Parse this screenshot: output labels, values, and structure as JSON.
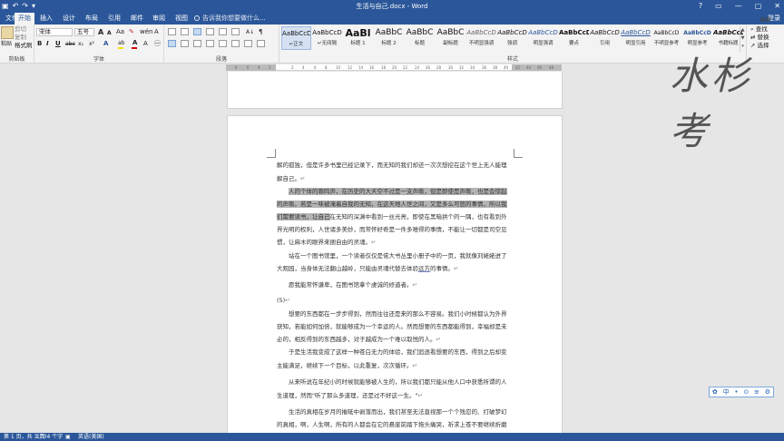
{
  "window": {
    "title": "生活与自己.docx - Word",
    "controls": [
      "?",
      "▭",
      "—",
      "▢",
      "✕"
    ]
  },
  "quick_access": [
    "save-icon",
    "undo-icon",
    "redo-icon",
    "customize-icon"
  ],
  "tabs": {
    "file": "文件",
    "home": "开始",
    "insert": "插入",
    "design": "设计",
    "layout": "布局",
    "references": "引用",
    "mailings": "邮件",
    "review": "审阅",
    "view": "视图",
    "tell_me": "告诉我你想要做什么...",
    "sign_in": "登录"
  },
  "clipboard": {
    "paste": "粘贴",
    "cut": "剪切",
    "copy": "复制",
    "format_painter": "格式刷",
    "label": "剪贴板"
  },
  "font": {
    "name": "宋体",
    "size": "五号",
    "grow": "A",
    "shrink": "A",
    "case": "Aa",
    "bold": "B",
    "italic": "I",
    "underline": "U",
    "strike": "abc",
    "sub": "x₂",
    "sup": "x²",
    "effects": "A",
    "highlight": "ab",
    "color": "A",
    "label": "字体",
    "highlight_color": "#f2e000",
    "font_color": "#d40000"
  },
  "paragraph": {
    "label": "段落",
    "sort": "A↓",
    "marks": "¶"
  },
  "styles": {
    "label": "样式",
    "items": [
      {
        "preview": "AaBbCcD",
        "name": "↵正文"
      },
      {
        "preview": "AaBbCcD",
        "name": "↵无间隔"
      },
      {
        "preview": "AaBl",
        "name": "标题 1"
      },
      {
        "preview": "AaBbC",
        "name": "标题 2"
      },
      {
        "preview": "AaBbC",
        "name": "标题"
      },
      {
        "preview": "AaBbC",
        "name": "副标题"
      },
      {
        "preview": "AaBbCcD",
        "name": "不明显强调"
      },
      {
        "preview": "AaBbCcD",
        "name": "强调"
      },
      {
        "preview": "AaBbCcD",
        "name": "明显强调"
      },
      {
        "preview": "AaBbCcD",
        "name": "要点"
      },
      {
        "preview": "AaBbCcD",
        "name": "引用"
      },
      {
        "preview": "AaBbCcD",
        "name": "明显引用"
      },
      {
        "preview": "AaBbCcD",
        "name": "不明显参考"
      },
      {
        "preview": "AaBbCcD",
        "name": "明显参考"
      },
      {
        "preview": "AaBbCcD",
        "name": "书籍标题"
      }
    ]
  },
  "editing": {
    "find": "查找",
    "replace": "替换",
    "select": "选择",
    "label": "编辑"
  },
  "ruler_ticks": [
    "8",
    "6",
    "4",
    "2",
    "",
    "2",
    "4",
    "6",
    "8",
    "10",
    "12",
    "14",
    "16",
    "18",
    "20",
    "22",
    "24",
    "26",
    "28",
    "30",
    "32",
    "34",
    "36",
    "38",
    "40",
    "42",
    "44",
    "46",
    "48"
  ],
  "document": {
    "lines": [
      {
        "pre": "解的孤独，但是许多书里已经记录下，而无知的我们却还一次次想挖在这个世上无人能理",
        "hl": "",
        "post": "",
        "ul": ""
      },
      {
        "pre": "解自己。",
        "hl": "",
        "post": "",
        "ul": "",
        "mark": "↵"
      },
      {
        "pre": "",
        "hl": "人的个体的嘶鸣声，在历史的大天空不过是一支声嘶，但是即使是声嘶，也是会惊起",
        "post": "",
        "ul": ""
      },
      {
        "pre": "",
        "hl": "的声嘶。若是一味被淹着自我的无知，在这天地人世之间，又是多么可怒的事情，所以我",
        "post": "",
        "ul": ""
      },
      {
        "pre": "",
        "hl": "们需要读书，让自己",
        "post": "在无知的深渊中看到一丝光亮，即使在黑暗拱个的一隅，也有看到外",
        "ul": ""
      },
      {
        "pre": "界光明的权利，人世诸多美妙，而常怀好奇是一件多难得的事情，不能让一切都是司空见",
        "hl": "",
        "post": "",
        "ul": ""
      },
      {
        "pre": "惯，让麻木的眼界来捆自由的灵魂。",
        "hl": "",
        "post": "",
        "ul": "",
        "mark": "↵"
      },
      {
        "pre": "站在一个图书馆里，一个读者仅仅是偌大书丛里小册子中的一页，我就像刘姥姥进了",
        "hl": "",
        "post": "",
        "ul": ""
      },
      {
        "pre": "大观园，当身体无法翻山越岭，只能由灵魂代替去体验",
        "hl": "",
        "post": "的事情。",
        "ul": "远方",
        "mark": "↵"
      },
      {
        "pre": "愿我能常怀谦卑，在图书馆拿个虔诚的修道者。",
        "hl": "",
        "post": "",
        "ul": "",
        "mark": "↵"
      },
      {
        "pre": "(5)",
        "hl": "",
        "post": "",
        "ul": "",
        "mark": "↵"
      },
      {
        "pre": "想要的东西都在一步步得到，然而往往还是来的那么不容易。我们小时候都认为外界",
        "hl": "",
        "post": "",
        "ul": ""
      },
      {
        "pre": "获知，若能如何加倍，就能够成为一个幸运的人。然而想要的东西都能得到，幸福却是未",
        "hl": "",
        "post": "",
        "ul": ""
      },
      {
        "pre": "必的，相反得到的东西越多，对于越成为一个难以取悦的人。",
        "hl": "",
        "post": "",
        "ul": "",
        "mark": "↵"
      },
      {
        "pre": "于是生活我变成了这样一种苍白无力的体验，我们追逐看想要的东西，得到之后却变",
        "hl": "",
        "post": "",
        "ul": ""
      },
      {
        "pre": "主能满足，继续下一个目标，以此重复，次次循环。",
        "hl": "",
        "post": "",
        "ul": "",
        "mark": "↵"
      },
      {
        "pre": "从来听说在年纪小的时候就能够被人生的，所以我们都只能从他人口中获悉所谓的人",
        "hl": "",
        "post": "",
        "ul": ""
      },
      {
        "pre": "生道理，然而\"听了那么多道理，还是过不好这一生。\"",
        "hl": "",
        "post": "",
        "ul": "",
        "mark": "↵"
      },
      {
        "pre": "生活的真相在岁月的摧砥中剥落而出，我们甚至无法直视那一个个残忍的、打破梦幻",
        "hl": "",
        "post": "",
        "ul": ""
      },
      {
        "pre": "的真相，啊，人生啊，所有的人都会在它的悬崖前踏下拖头痛哭，祈求上苍不要继续折磨",
        "hl": "",
        "post": "",
        "ul": ""
      }
    ]
  },
  "watermark": "水杉考",
  "ime": [
    "中",
    "•",
    "⊙",
    "≡",
    "⚙"
  ],
  "status": {
    "page": "第 1 页，共 3 页",
    "words": "1704 个字",
    "lang": "英语(美国)"
  }
}
